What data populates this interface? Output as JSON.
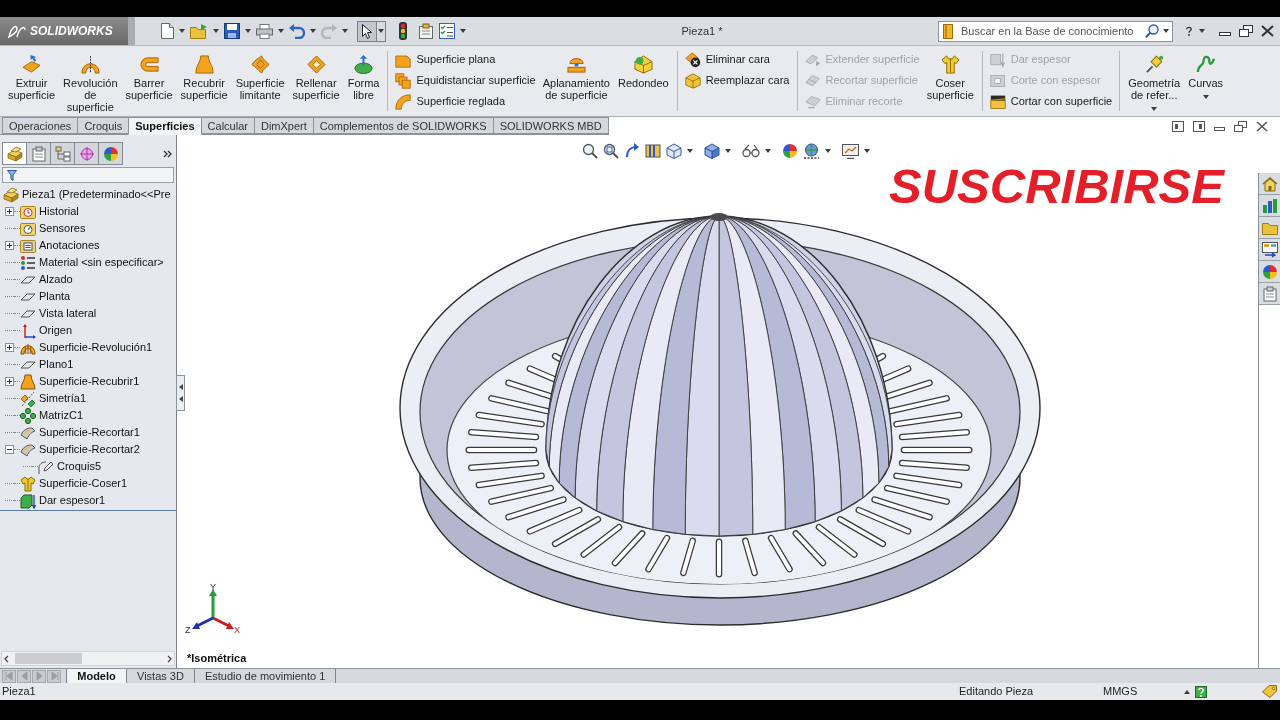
{
  "title_bar": {
    "logo": "SOLIDWORKS",
    "document": "Pieza1 *",
    "search": {
      "placeholder": "Buscar en la Base de conocimiento"
    }
  },
  "ribbon": {
    "groups": [
      {
        "items": [
          {
            "kind": "large",
            "lines": [
              "Extruir",
              "superficie"
            ],
            "disabled": false,
            "menu": false
          },
          {
            "kind": "large",
            "lines": [
              "Revolución",
              "de",
              "superficie"
            ],
            "disabled": false,
            "menu": false
          },
          {
            "kind": "large",
            "lines": [
              "Barrer",
              "superficie"
            ],
            "disabled": false,
            "menu": false
          },
          {
            "kind": "large",
            "lines": [
              "Recubrir",
              "superficie"
            ],
            "disabled": false,
            "menu": false
          },
          {
            "kind": "large",
            "lines": [
              "Superficie",
              "limitante"
            ],
            "disabled": false,
            "menu": false
          },
          {
            "kind": "large",
            "lines": [
              "Rellenar",
              "superficie"
            ],
            "disabled": false,
            "menu": false
          },
          {
            "kind": "large",
            "lines": [
              "Forma",
              "libre"
            ],
            "disabled": false,
            "menu": false
          }
        ]
      },
      {
        "items": [
          {
            "kind": "stack",
            "items": [
              {
                "label": "Superficie plana",
                "disabled": false
              },
              {
                "label": "Equidistanciar superficie",
                "disabled": false
              },
              {
                "label": "Superficie reglada",
                "disabled": false
              }
            ]
          },
          {
            "kind": "large",
            "lines": [
              "Aplanamiento",
              "de superficie"
            ],
            "disabled": false,
            "menu": false
          },
          {
            "kind": "large",
            "lines": [
              "Redondeo"
            ],
            "disabled": false,
            "menu": false
          }
        ]
      },
      {
        "items": [
          {
            "kind": "stack",
            "items": [
              {
                "label": "Eliminar cara",
                "disabled": false
              },
              {
                "label": "Reemplazar cara",
                "disabled": false
              }
            ]
          }
        ]
      },
      {
        "items": [
          {
            "kind": "stack",
            "items": [
              {
                "label": "Extender superficie",
                "disabled": true
              },
              {
                "label": "Recortar superficie",
                "disabled": true
              },
              {
                "label": "Eliminar recorte",
                "disabled": true
              }
            ]
          },
          {
            "kind": "large",
            "lines": [
              "Coser",
              "superficie"
            ],
            "disabled": false,
            "menu": false
          }
        ]
      },
      {
        "items": [
          {
            "kind": "stack",
            "items": [
              {
                "label": "Dar espesor",
                "disabled": true
              },
              {
                "label": "Corte con espesor",
                "disabled": true
              },
              {
                "label": "Cortar con superficie",
                "disabled": false
              }
            ]
          }
        ]
      },
      {
        "items": [
          {
            "kind": "large",
            "lines": [
              "Geometría",
              "de refer..."
            ],
            "disabled": false,
            "menu": true
          },
          {
            "kind": "large",
            "lines": [
              "Curvas"
            ],
            "disabled": false,
            "menu": true
          }
        ]
      }
    ]
  },
  "command_tabs": [
    {
      "label": "Operaciones",
      "selected": false
    },
    {
      "label": "Croquis",
      "selected": false
    },
    {
      "label": "Superficies",
      "selected": true
    },
    {
      "label": "Calcular",
      "selected": false
    },
    {
      "label": "DimXpert",
      "selected": false
    },
    {
      "label": "Complementos de SOLIDWORKS",
      "selected": false
    },
    {
      "label": "SOLIDWORKS MBD",
      "selected": false
    }
  ],
  "feature_manager": {
    "tabs": [
      {
        "selected": true
      },
      {
        "selected": false
      },
      {
        "selected": false
      },
      {
        "selected": false
      },
      {
        "selected": false
      }
    ],
    "tree": {
      "label": "Pieza1 (Predeterminado<<Pre",
      "kind": "part",
      "children": [
        {
          "label": "Historial",
          "kind": "history",
          "expanded": false
        },
        {
          "label": "Sensores",
          "kind": "sensors"
        },
        {
          "label": "Anotaciones",
          "kind": "annotations",
          "expanded": false
        },
        {
          "label": "Material <sin especificar>",
          "kind": "material"
        },
        {
          "label": "Alzado",
          "kind": "plane"
        },
        {
          "label": "Planta",
          "kind": "plane"
        },
        {
          "label": "Vista lateral",
          "kind": "plane"
        },
        {
          "label": "Origen",
          "kind": "origin"
        },
        {
          "label": "Superficie-Revolución1",
          "kind": "revolve",
          "expanded": false
        },
        {
          "label": "Plano1",
          "kind": "plane"
        },
        {
          "label": "Superficie-Recubrir1",
          "kind": "loft",
          "expanded": false
        },
        {
          "label": "Simetría1",
          "kind": "mirror"
        },
        {
          "label": "MatrizC1",
          "kind": "pattern"
        },
        {
          "label": "Superficie-Recortar1",
          "kind": "trim"
        },
        {
          "label": "Superficie-Recortar2",
          "kind": "trim",
          "expanded": true,
          "children": [
            {
              "label": "Croquis5",
              "kind": "sketch"
            }
          ]
        },
        {
          "label": "Superficie-Coser1",
          "kind": "knit"
        },
        {
          "label": "Dar espesor1",
          "kind": "thicken"
        }
      ]
    }
  },
  "viewport": {
    "overlay_text": "SUSCRIBIRSE",
    "view_name": "*Isométrica",
    "triad": {
      "x_label": "X",
      "y_label": "Y",
      "z_label": "Z"
    }
  },
  "model_tabs": [
    {
      "label": "Modelo",
      "selected": true
    },
    {
      "label": "Vistas 3D",
      "selected": false
    },
    {
      "label": "Estudio de movimiento 1",
      "selected": false
    }
  ],
  "status_bar": {
    "document": "Pieza1",
    "mode": "Editando Pieza",
    "units": "MMGS"
  }
}
